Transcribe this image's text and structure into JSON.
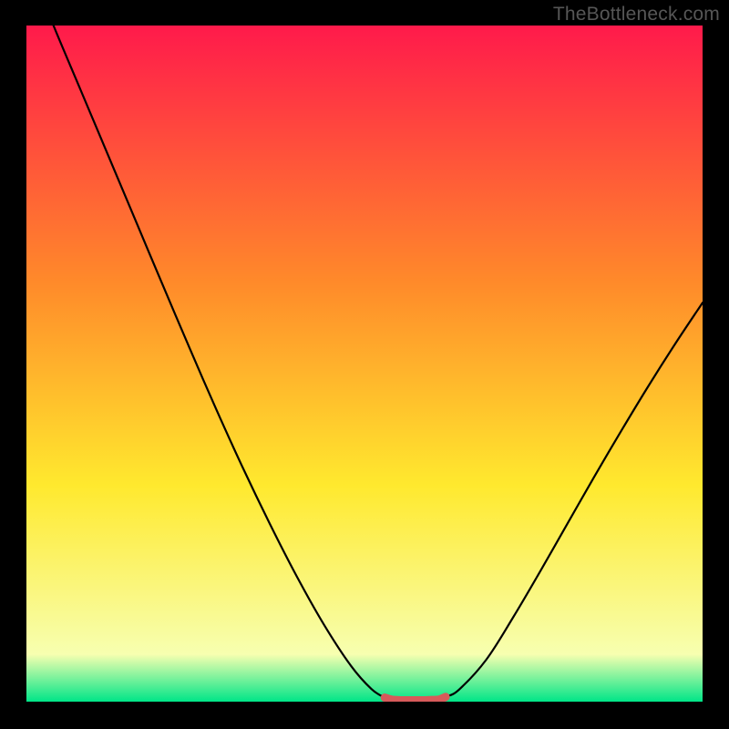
{
  "attribution": "TheBottleneck.com",
  "colors": {
    "bg": "#000000",
    "gradient_top": "#ff1a4b",
    "gradient_mid1": "#ff8a2a",
    "gradient_mid2": "#ffe92e",
    "gradient_mid3": "#f7ffb0",
    "gradient_bottom": "#00e588",
    "curve": "#000000",
    "highlight": "#d75a5a"
  },
  "chart_data": {
    "type": "line",
    "title": "",
    "xlabel": "",
    "ylabel": "",
    "xlim": [
      0,
      100
    ],
    "ylim": [
      0,
      100
    ],
    "series": [
      {
        "name": "bottleneck-curve",
        "x": [
          0,
          4,
          8,
          12,
          16,
          20,
          24,
          28,
          32,
          36,
          40,
          44,
          48,
          51,
          53,
          54,
          56,
          59,
          61,
          62,
          64,
          68,
          72,
          76,
          80,
          84,
          88,
          92,
          96,
          100
        ],
        "y": [
          110,
          100,
          90.5,
          81,
          71.5,
          62,
          52.6,
          43.4,
          34.6,
          26.3,
          18.5,
          11.4,
          5.3,
          1.9,
          0.6,
          0.3,
          0.2,
          0.2,
          0.3,
          0.7,
          1.8,
          6.2,
          12.5,
          19.3,
          26.3,
          33.3,
          40.1,
          46.7,
          53.0,
          59.0
        ]
      },
      {
        "name": "optimal-range-highlight",
        "x": [
          53,
          54,
          55,
          56,
          57,
          58,
          59,
          60,
          61,
          62
        ],
        "y": [
          0.6,
          0.3,
          0.22,
          0.2,
          0.2,
          0.2,
          0.2,
          0.25,
          0.3,
          0.7
        ]
      }
    ],
    "annotations": []
  }
}
